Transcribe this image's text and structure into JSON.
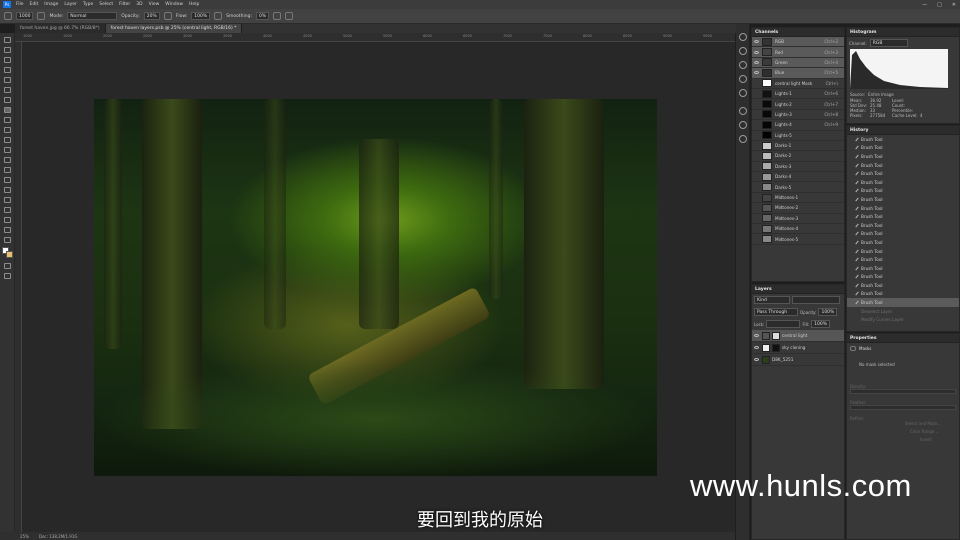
{
  "menubar": {
    "items": [
      "File",
      "Edit",
      "Image",
      "Layer",
      "Type",
      "Select",
      "Filter",
      "3D",
      "View",
      "Window",
      "Help"
    ],
    "app_logo": "Ps",
    "window_controls": [
      "—",
      "□",
      "✕"
    ]
  },
  "options": {
    "brush_size": "1000",
    "mode_label": "Mode:",
    "mode_value": "Normal",
    "opacity_label": "Opacity:",
    "opacity_value": "20%",
    "flow_label": "Flow:",
    "flow_value": "100%",
    "smoothing_label": "Smoothing:",
    "smoothing_value": "0%"
  },
  "tabs": [
    {
      "label": "forest haven.jpg @ 66.7% (RGB/8*)"
    },
    {
      "label": "forest haven layers.psb @ 25% (central light, RGB/16) *"
    }
  ],
  "ruler_ticks": [
    "1000",
    "1500",
    "2000",
    "2500",
    "3000",
    "3500",
    "4000",
    "4500",
    "5000",
    "5500",
    "6000",
    "6500",
    "7000",
    "7500",
    "8000",
    "8500",
    "9000",
    "9500"
  ],
  "statusbar": {
    "zoom": "25%",
    "doc": "Doc: 138.2M/1.91G"
  },
  "subtitle": "要回到我的原始",
  "watermark": "www.hunls.com",
  "channels": {
    "title": "Channels",
    "rows": [
      {
        "name": "RGB",
        "shortcut": "Ctrl+2"
      },
      {
        "name": "Red",
        "shortcut": "Ctrl+3"
      },
      {
        "name": "Green",
        "shortcut": "Ctrl+4"
      },
      {
        "name": "Blue",
        "shortcut": "Ctrl+5"
      },
      {
        "name": "central light Mask",
        "shortcut": "Ctrl+\\"
      },
      {
        "name": "Lights-1",
        "shortcut": "Ctrl+6"
      },
      {
        "name": "Lights-2",
        "shortcut": "Ctrl+7"
      },
      {
        "name": "Lights-3",
        "shortcut": "Ctrl+8"
      },
      {
        "name": "Lights-4",
        "shortcut": "Ctrl+9"
      },
      {
        "name": "Lights-5",
        "shortcut": ""
      },
      {
        "name": "Darks-1",
        "shortcut": ""
      },
      {
        "name": "Darks-2",
        "shortcut": ""
      },
      {
        "name": "Darks-3",
        "shortcut": ""
      },
      {
        "name": "Darks-4",
        "shortcut": ""
      },
      {
        "name": "Darks-5",
        "shortcut": ""
      },
      {
        "name": "Midtones-1",
        "shortcut": ""
      },
      {
        "name": "Midtones-2",
        "shortcut": ""
      },
      {
        "name": "Midtones-3",
        "shortcut": ""
      },
      {
        "name": "Midtones-4",
        "shortcut": ""
      },
      {
        "name": "Midtones-5",
        "shortcut": ""
      }
    ]
  },
  "histogram": {
    "title": "Histogram",
    "channel_label": "Channel:",
    "channel_value": "RGB",
    "source_label": "Source:",
    "source_value": "Entire Image",
    "stats": {
      "mean_label": "Mean:",
      "mean": "36.92",
      "stddev_label": "Std Dev:",
      "stddev": "25.48",
      "median_label": "Median:",
      "median": "33",
      "pixels_label": "Pixels:",
      "pixels": "277584",
      "level_label": "Level:",
      "count_label": "Count:",
      "percentile_label": "Percentile:",
      "cache_label": "Cache Level:",
      "cache": "4"
    }
  },
  "history": {
    "title": "History",
    "items": [
      "Brush Tool",
      "Brush Tool",
      "Brush Tool",
      "Brush Tool",
      "Brush Tool",
      "Brush Tool",
      "Brush Tool",
      "Brush Tool",
      "Brush Tool",
      "Brush Tool",
      "Brush Tool",
      "Brush Tool",
      "Brush Tool",
      "Brush Tool",
      "Brush Tool",
      "Brush Tool",
      "Brush Tool",
      "Brush Tool",
      "Brush Tool",
      "Brush Tool"
    ],
    "dim_items": [
      "Deselect Layer",
      "Modify Curves Layer"
    ]
  },
  "layers": {
    "title": "Layers",
    "filter_value": "Kind",
    "blend_value": "Pass Through",
    "opacity_label": "Opacity:",
    "opacity_value": "100%",
    "lock_label": "Lock:",
    "fill_label": "Fill:",
    "fill_value": "100%",
    "rows": [
      {
        "name": "central light"
      },
      {
        "name": "sky cloning"
      },
      {
        "name": "D8K_5251"
      }
    ]
  },
  "properties": {
    "title": "Properties",
    "section": "Masks",
    "status": "No mask selected",
    "density_label": "Density:",
    "feather_label": "Feather:",
    "refine_label": "Refine:",
    "btn_select_mask": "Select and Mask...",
    "btn_color_range": "Color Range...",
    "btn_invert": "Invert"
  },
  "colors": {
    "ps_blue": "#1473e6",
    "fg_color": "#ffffff",
    "bg_color": "#e8c070"
  }
}
